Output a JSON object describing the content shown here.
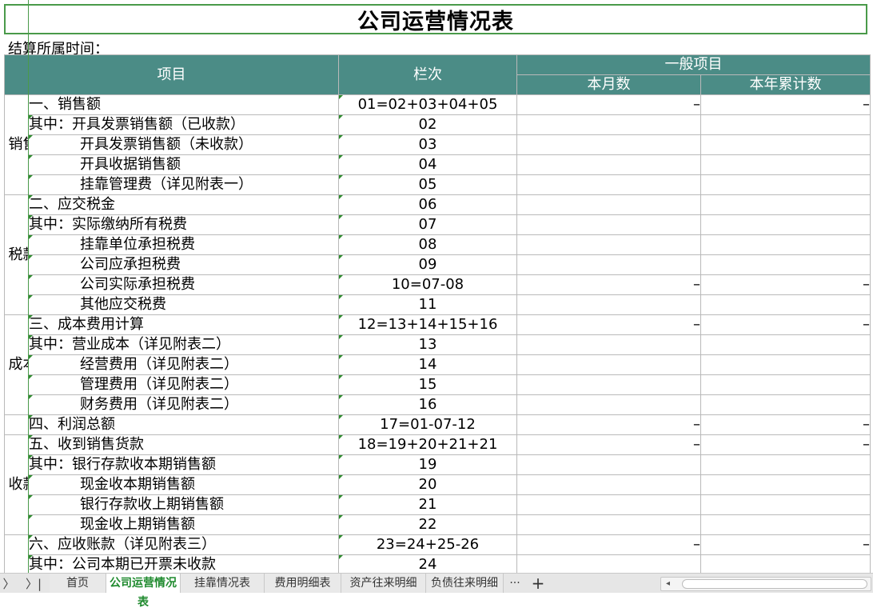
{
  "title": "公司运营情况表",
  "subtitle": "结算所属时间：",
  "headers": {
    "item": "项目",
    "column": "栏次",
    "general": "一般项目",
    "month": "本月数",
    "year": "本年累计数"
  },
  "categories": {
    "sales": "销售额",
    "tax": "税款计算",
    "cost": "成本费用计算",
    "collect": "收款计算"
  },
  "rows": [
    {
      "name": "一、销售额",
      "code": "01=02+03+04+05",
      "month": "–",
      "year": "–"
    },
    {
      "name": "其中：开具发票销售额（已收款）",
      "code": "02",
      "month": "",
      "year": ""
    },
    {
      "name": "开具发票销售额（未收款）",
      "code": "03",
      "month": "",
      "year": ""
    },
    {
      "name": "开具收据销售额",
      "code": "04",
      "month": "",
      "year": ""
    },
    {
      "name": "挂靠管理费（详见附表一）",
      "code": "05",
      "month": "",
      "year": ""
    },
    {
      "name": "二、应交税金",
      "code": "06",
      "month": "",
      "year": ""
    },
    {
      "name": "其中：实际缴纳所有税费",
      "code": "07",
      "month": "",
      "year": ""
    },
    {
      "name": "挂靠单位承担税费",
      "code": "08",
      "month": "",
      "year": ""
    },
    {
      "name": "公司应承担税费",
      "code": "09",
      "month": "",
      "year": ""
    },
    {
      "name": "公司实际承担税费",
      "code": "10=07-08",
      "month": "–",
      "year": "–"
    },
    {
      "name": "其他应交税费",
      "code": "11",
      "month": "",
      "year": ""
    },
    {
      "name": "三、成本费用计算",
      "code": "12=13+14+15+16",
      "month": "–",
      "year": "–"
    },
    {
      "name": "其中：营业成本（详见附表二）",
      "code": "13",
      "month": "",
      "year": ""
    },
    {
      "name": "经营费用（详见附表二）",
      "code": "14",
      "month": "",
      "year": ""
    },
    {
      "name": "管理费用（详见附表二）",
      "code": "15",
      "month": "",
      "year": ""
    },
    {
      "name": "财务费用（详见附表二）",
      "code": "16",
      "month": "",
      "year": ""
    },
    {
      "name": "四、利润总额",
      "code": "17=01-07-12",
      "month": "–",
      "year": "–"
    },
    {
      "name": "五、收到销售货款",
      "code": "18=19+20+21+21",
      "month": "–",
      "year": "–"
    },
    {
      "name": "其中：银行存款收本期销售额",
      "code": "19",
      "month": "",
      "year": ""
    },
    {
      "name": "现金收本期销售额",
      "code": "20",
      "month": "",
      "year": ""
    },
    {
      "name": "银行存款收上期销售额",
      "code": "21",
      "month": "",
      "year": ""
    },
    {
      "name": "现金收上期销售额",
      "code": "22",
      "month": "",
      "year": ""
    },
    {
      "name": "六、应收账款（详见附表三）",
      "code": "23=24+25-26",
      "month": "–",
      "year": "–"
    },
    {
      "name": "其中：公司本期已开票未收款",
      "code": "24",
      "month": "",
      "year": ""
    }
  ],
  "tabs": [
    "首页",
    "公司运营情况表",
    "挂靠情况表",
    "费用明细表",
    "资产往来明细",
    "负债往来明细"
  ],
  "active_tab": "公司运营情况表",
  "tabbar": {
    "more": "···",
    "add": "+",
    "first": "〉",
    "last": "〉|",
    "scroll_left": "◂"
  },
  "colors": {
    "header_bg": "#4b8c86",
    "active_tab_text": "#1f8a2e"
  }
}
